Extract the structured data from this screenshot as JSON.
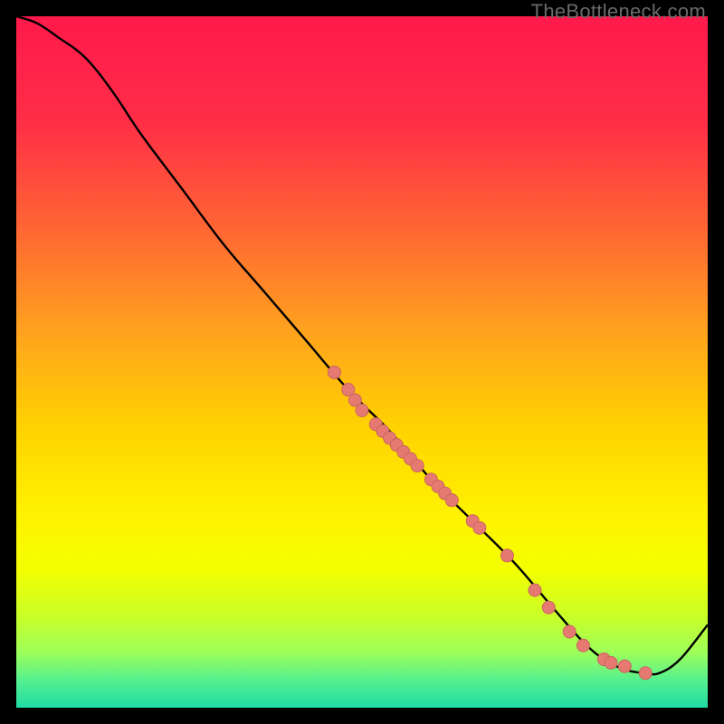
{
  "watermark": "TheBottleneck.com",
  "colors": {
    "axis": "#000000",
    "line": "#000000",
    "neutral": "#ffea00",
    "dot_fill": "#e67a72",
    "dot_stroke": "#c9665f"
  },
  "chart_data": {
    "type": "line",
    "title": "",
    "xlabel": "",
    "ylabel": "",
    "xlim": [
      0,
      100
    ],
    "ylim": [
      0,
      100
    ],
    "axes_visible": false,
    "background_gradient": {
      "stops": [
        {
          "offset": 0.0,
          "color": "#ff1a4b"
        },
        {
          "offset": 0.15,
          "color": "#ff2d47"
        },
        {
          "offset": 0.3,
          "color": "#ff6334"
        },
        {
          "offset": 0.45,
          "color": "#ffa01f"
        },
        {
          "offset": 0.6,
          "color": "#ffd400"
        },
        {
          "offset": 0.72,
          "color": "#fff200"
        },
        {
          "offset": 0.8,
          "color": "#f4ff00"
        },
        {
          "offset": 0.87,
          "color": "#c8ff2a"
        },
        {
          "offset": 0.92,
          "color": "#9dff5a"
        },
        {
          "offset": 0.96,
          "color": "#56f08f"
        },
        {
          "offset": 1.0,
          "color": "#1fdca5"
        }
      ]
    },
    "series": [
      {
        "name": "curve",
        "x": [
          0,
          3,
          6,
          10,
          14,
          18,
          24,
          30,
          36,
          42,
          48,
          54,
          60,
          66,
          72,
          78,
          82,
          85,
          88,
          91,
          93,
          96,
          100
        ],
        "y": [
          100,
          99,
          97,
          94,
          89,
          83,
          75,
          67,
          60,
          53,
          46,
          40,
          33,
          27,
          21,
          14,
          9.5,
          7,
          5.5,
          5,
          5,
          7,
          12
        ]
      }
    ],
    "scatter": [
      {
        "x": 46,
        "y": 48.5
      },
      {
        "x": 48,
        "y": 46.0
      },
      {
        "x": 49,
        "y": 44.5
      },
      {
        "x": 50,
        "y": 43.0
      },
      {
        "x": 52,
        "y": 41.0
      },
      {
        "x": 53,
        "y": 40.0
      },
      {
        "x": 54,
        "y": 39.0
      },
      {
        "x": 55,
        "y": 38.0
      },
      {
        "x": 56,
        "y": 37.0
      },
      {
        "x": 57,
        "y": 36.0
      },
      {
        "x": 58,
        "y": 35.0
      },
      {
        "x": 60,
        "y": 33.0
      },
      {
        "x": 61,
        "y": 32.0
      },
      {
        "x": 62,
        "y": 31.0
      },
      {
        "x": 63,
        "y": 30.0
      },
      {
        "x": 66,
        "y": 27.0
      },
      {
        "x": 67,
        "y": 26.0
      },
      {
        "x": 71,
        "y": 22.0
      },
      {
        "x": 75,
        "y": 17.0
      },
      {
        "x": 77,
        "y": 14.5
      },
      {
        "x": 80,
        "y": 11.0
      },
      {
        "x": 82,
        "y": 9.0
      },
      {
        "x": 85,
        "y": 7.0
      },
      {
        "x": 86,
        "y": 6.5
      },
      {
        "x": 88,
        "y": 6.0
      },
      {
        "x": 91,
        "y": 5.0
      }
    ],
    "dot_radius": 7
  }
}
